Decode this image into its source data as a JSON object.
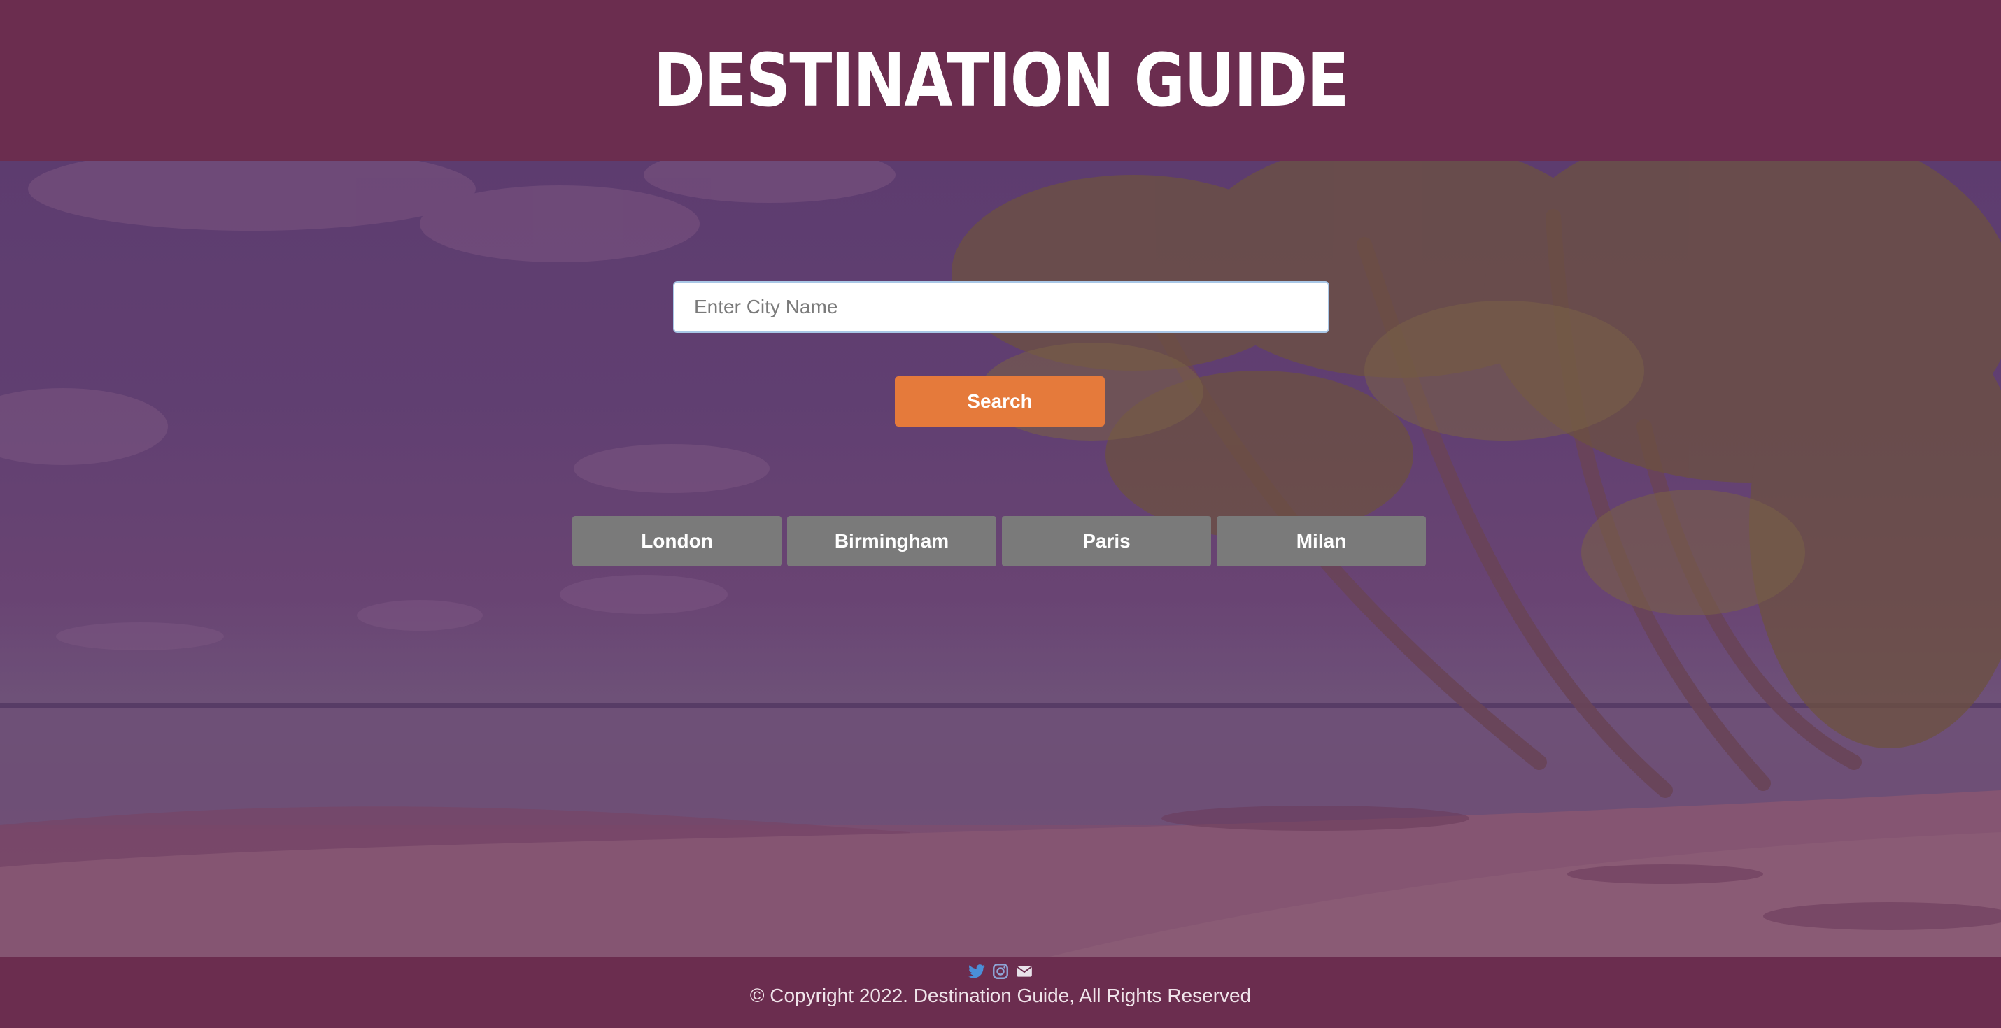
{
  "header": {
    "title": "DESTINATION GUIDE"
  },
  "search": {
    "placeholder": "Enter City Name",
    "value": "",
    "button_label": "Search"
  },
  "cities": [
    {
      "label": "London"
    },
    {
      "label": "Birmingham"
    },
    {
      "label": "Paris"
    },
    {
      "label": "Milan"
    }
  ],
  "footer": {
    "social_icons": [
      "twitter-icon",
      "instagram-icon",
      "email-icon"
    ],
    "copyright": "© Copyright 2022. Destination Guide, All Rights Reserved"
  },
  "colors": {
    "header_bg": "#6b2d4f",
    "search_button": "#e57a3b",
    "city_button": "#7a7a7a",
    "twitter": "#4a8fd9",
    "instagram": "#8fa6d8"
  }
}
